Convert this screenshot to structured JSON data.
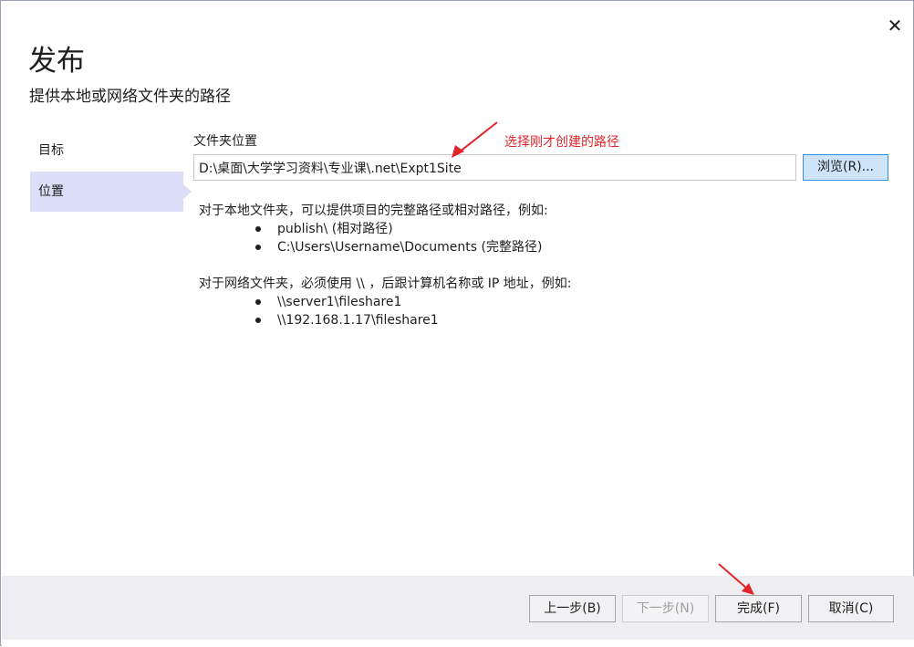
{
  "dialog": {
    "title": "发布",
    "subtitle": "提供本地或网络文件夹的路径",
    "close_glyph": "✕"
  },
  "nav": {
    "items": [
      {
        "label": "目标",
        "active": false
      },
      {
        "label": "位置",
        "active": true
      }
    ]
  },
  "location": {
    "field_label": "文件夹位置",
    "path_value": "D:\\桌面\\大学学习资料\\专业课\\.net\\Expt1Site",
    "browse_label": "浏览(R)..."
  },
  "help": {
    "local_intro": "对于本地文件夹，可以提供项目的完整路径或相对路径，例如:",
    "local_examples": [
      "publish\\ (相对路径)",
      "C:\\Users\\Username\\Documents (完整路径)"
    ],
    "network_intro": "对于网络文件夹，必须使用 \\\\ ，后跟计算机名称或 IP 地址，例如:",
    "network_examples": [
      "\\\\server1\\fileshare1",
      "\\\\192.168.1.17\\fileshare1"
    ]
  },
  "annotation": {
    "text": "选择刚才创建的路径",
    "color": "#e0252b"
  },
  "footer": {
    "prev_label": "上一步(B)",
    "next_label": "下一步(N)",
    "next_disabled": true,
    "finish_label": "完成(F)",
    "cancel_label": "取消(C)"
  },
  "colors": {
    "nav_active_bg": "#dcdef8",
    "browse_bg": "#cfe4f9",
    "browse_border": "#3a8ee0",
    "footer_bg": "#eeeef2"
  }
}
